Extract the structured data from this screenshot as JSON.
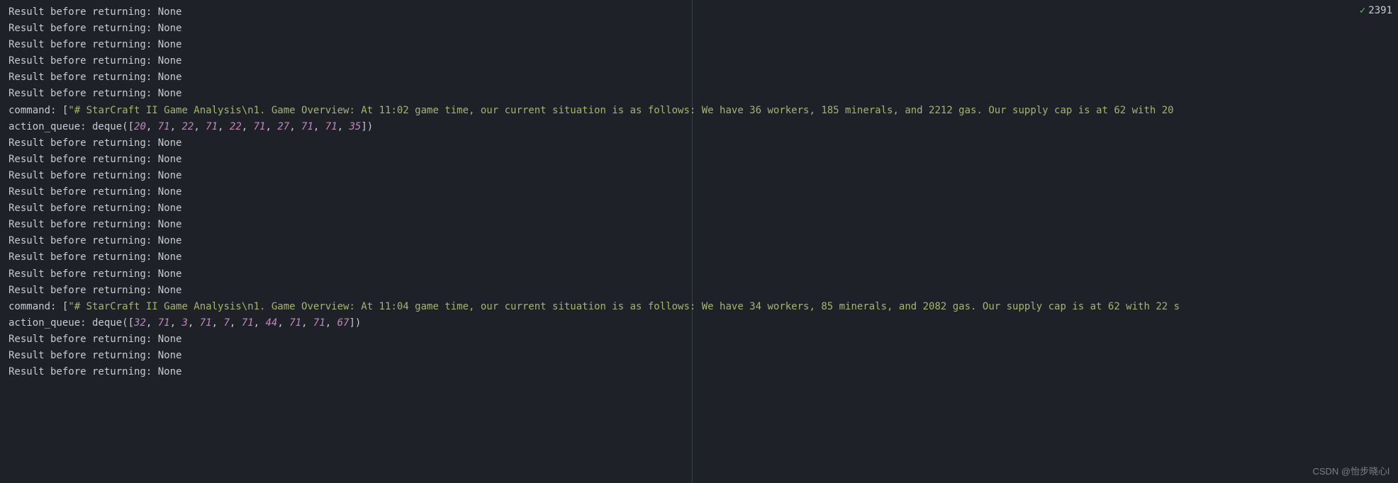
{
  "status": {
    "count": "2391"
  },
  "watermark": "CSDN @怡步晓心l",
  "lines": [
    {
      "type": "result",
      "text": "Result before returning: None"
    },
    {
      "type": "result",
      "text": "Result before returning: None"
    },
    {
      "type": "result",
      "text": "Result before returning: None"
    },
    {
      "type": "result",
      "text": "Result before returning: None"
    },
    {
      "type": "result",
      "text": "Result before returning: None"
    },
    {
      "type": "result",
      "text": "Result before returning: None"
    },
    {
      "type": "command",
      "prefix": "command: [",
      "content": "\"# StarCraft II Game Analysis\\n1. Game Overview: At 11:02 game time, our current situation is as follows: We have 36 workers, 185 minerals, and 2212 gas. Our supply cap is at 62 with 20"
    },
    {
      "type": "action_queue",
      "prefix": "action_queue: deque([",
      "values": [
        20,
        71,
        22,
        71,
        22,
        71,
        27,
        71,
        71,
        35
      ],
      "suffix": "])"
    },
    {
      "type": "result",
      "text": "Result before returning: None"
    },
    {
      "type": "result",
      "text": "Result before returning: None"
    },
    {
      "type": "result",
      "text": "Result before returning: None"
    },
    {
      "type": "result",
      "text": "Result before returning: None"
    },
    {
      "type": "result",
      "text": "Result before returning: None"
    },
    {
      "type": "result",
      "text": "Result before returning: None"
    },
    {
      "type": "result",
      "text": "Result before returning: None"
    },
    {
      "type": "result",
      "text": "Result before returning: None"
    },
    {
      "type": "result",
      "text": "Result before returning: None"
    },
    {
      "type": "result",
      "text": "Result before returning: None"
    },
    {
      "type": "command",
      "prefix": "command: [",
      "content": "\"# StarCraft II Game Analysis\\n1. Game Overview: At 11:04 game time, our current situation is as follows: We have 34 workers, 85 minerals, and 2082 gas. Our supply cap is at 62 with 22 s"
    },
    {
      "type": "action_queue",
      "prefix": "action_queue: deque([",
      "values": [
        32,
        71,
        3,
        71,
        7,
        71,
        44,
        71,
        71,
        67
      ],
      "suffix": "])"
    },
    {
      "type": "result",
      "text": "Result before returning: None"
    },
    {
      "type": "result",
      "text": "Result before returning: None"
    },
    {
      "type": "result",
      "text": "Result before returning: None"
    }
  ]
}
